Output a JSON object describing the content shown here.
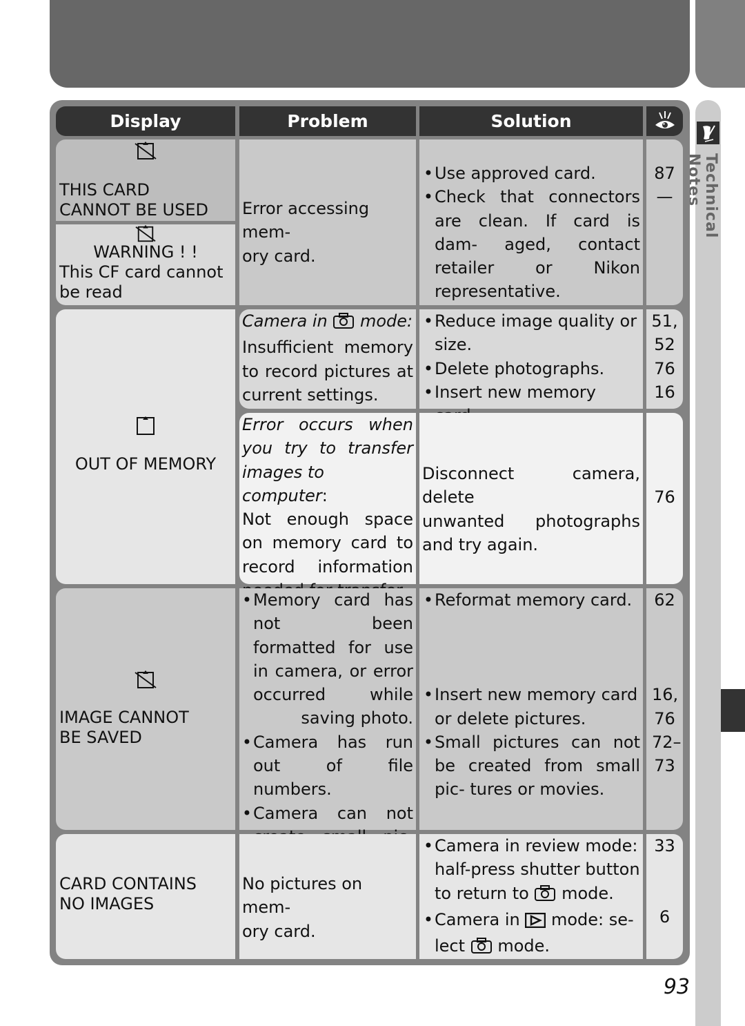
{
  "header": {
    "display": "Display",
    "problem": "Problem",
    "solution": "Solution",
    "reference_icon": "eye-icon"
  },
  "side_tab": {
    "label": "Technical Notes",
    "icon": "pen-paper-icon"
  },
  "page_number": "93",
  "rows": [
    {
      "display": [
        {
          "icon": "card-crossed-icon",
          "text": [
            "THIS CARD",
            "CANNOT BE USED"
          ]
        },
        {
          "icon": "card-crossed-icon",
          "text": [
            "WARNING ! !",
            "This CF card cannot",
            "be read"
          ]
        }
      ],
      "problem": [
        "Error accessing mem-",
        "ory card."
      ],
      "solution": [
        {
          "text": "Use approved card.",
          "ref": "87"
        },
        {
          "text": "Check that connectors are clean.  If card is dam- aged, contact retailer or Nikon representative.",
          "ref": "—"
        }
      ]
    },
    {
      "display": [
        {
          "icon": "card-icon",
          "text": [
            "OUT OF MEMORY"
          ]
        }
      ],
      "problem_a": {
        "italic_prefix": "Camera in",
        "icon": "camera-icon",
        "italic_suffix": "mode:",
        "lines": [
          "Insufficient memory",
          "to record pictures at",
          "current settings."
        ]
      },
      "solution_a": [
        {
          "text": "Reduce image quality or size.",
          "ref": "51, 52"
        },
        {
          "text": "Delete photographs.",
          "ref": "76"
        },
        {
          "text": "Insert new memory card.",
          "ref": "16"
        }
      ],
      "problem_b": {
        "italic_lines": [
          "Error occurs when",
          "you try to transfer",
          "images to computer"
        ],
        "lines": [
          "Not enough space",
          "on memory card to",
          "record information",
          "needed for transfer."
        ]
      },
      "solution_b": {
        "lines": [
          "Disconnect camera, delete",
          "unwanted photographs",
          "and try again."
        ],
        "ref": "76"
      }
    },
    {
      "display": [
        {
          "icon": "card-crossed-icon",
          "text": [
            "IMAGE CANNOT",
            "BE SAVED"
          ]
        }
      ],
      "problem": [
        "Memory card has not been formatted for use in camera, or error occurred while saving photo.",
        "Camera has run out of file numbers.",
        "Camera can not create small pic- ture."
      ],
      "solution": [
        {
          "text": "Reformat memory card.",
          "ref": "62"
        },
        {
          "text": "Insert new memory card or delete pictures.",
          "ref": "16, 76"
        },
        {
          "text": "Small pictures can not be created from small pic- tures or movies.",
          "ref": "72– 73"
        }
      ]
    },
    {
      "display": [
        {
          "text": [
            "CARD CONTAINS",
            "NO IMAGES"
          ]
        }
      ],
      "problem": [
        "No pictures on mem-",
        "ory card."
      ],
      "solution": [
        {
          "parts": [
            "Camera in review mode:",
            "half-press shutter button",
            "to return to",
            "mode."
          ],
          "icon": "camera-icon",
          "ref": "33"
        },
        {
          "parts": [
            "Camera in",
            "mode: se-",
            "lect",
            "mode."
          ],
          "icons": [
            "playback-icon",
            "camera-icon"
          ],
          "ref": "6"
        }
      ]
    }
  ]
}
